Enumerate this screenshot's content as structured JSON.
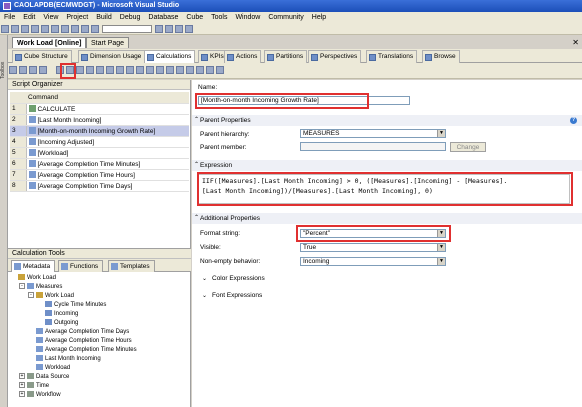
{
  "window": {
    "title": "CAOLAPDB(ECMWDGT) - Microsoft Visual Studio"
  },
  "menu": [
    "File",
    "Edit",
    "View",
    "Project",
    "Build",
    "Debug",
    "Database",
    "Cube",
    "Tools",
    "Window",
    "Community",
    "Help"
  ],
  "side_toolbox_label": "Toolbox",
  "document_tabs": [
    "Work Load [Online]",
    "Start Page"
  ],
  "designer_tabs": [
    "Cube Structure",
    "Dimension Usage",
    "Calculations",
    "KPIs",
    "Actions",
    "Partitions",
    "Perspectives",
    "Translations",
    "Browse"
  ],
  "active_designer_tab": "Calculations",
  "script_organizer": {
    "title": "Script Organizer",
    "column_header": "Command",
    "rows": [
      {
        "num": "1",
        "command": "CALCULATE"
      },
      {
        "num": "2",
        "command": "[Last Month Incoming]"
      },
      {
        "num": "3",
        "command": "[Month-on-month Incoming Growth Rate]"
      },
      {
        "num": "4",
        "command": "[Incoming Adjusted]"
      },
      {
        "num": "5",
        "command": "[Workload]"
      },
      {
        "num": "6",
        "command": "[Average Completion Time Minutes]"
      },
      {
        "num": "7",
        "command": "[Average Completion Time Hours]"
      },
      {
        "num": "8",
        "command": "[Average Completion Time Days]"
      }
    ],
    "selected_index": 2
  },
  "calc_tools": {
    "title": "Calculation Tools",
    "tabs": [
      "Metadata",
      "Functions",
      "Templates"
    ],
    "tree": [
      {
        "label": "Work Load",
        "indent": 0,
        "toggle": ""
      },
      {
        "label": "Measures",
        "indent": 1,
        "toggle": "-"
      },
      {
        "label": "Work Load",
        "indent": 2,
        "toggle": "-"
      },
      {
        "label": "Cycle Time Minutes",
        "indent": 3,
        "toggle": ""
      },
      {
        "label": "Incoming",
        "indent": 3,
        "toggle": ""
      },
      {
        "label": "Outgoing",
        "indent": 3,
        "toggle": ""
      },
      {
        "label": "Average Completion Time Days",
        "indent": 2,
        "toggle": ""
      },
      {
        "label": "Average Completion Time Hours",
        "indent": 2,
        "toggle": ""
      },
      {
        "label": "Average Completion Time Minutes",
        "indent": 2,
        "toggle": ""
      },
      {
        "label": "Last Month Incoming",
        "indent": 2,
        "toggle": ""
      },
      {
        "label": "Workload",
        "indent": 2,
        "toggle": ""
      },
      {
        "label": "Data Source",
        "indent": 1,
        "toggle": "+"
      },
      {
        "label": "Time",
        "indent": 1,
        "toggle": "+"
      },
      {
        "label": "Workflow",
        "indent": 1,
        "toggle": "+"
      }
    ]
  },
  "form": {
    "name_label": "Name:",
    "name_value": "[Month-on-month Incoming Growth Rate]",
    "parent_properties_label": "Parent Properties",
    "parent_hierarchy_label": "Parent hierarchy:",
    "parent_hierarchy_value": "MEASURES",
    "parent_member_label": "Parent member:",
    "change_button": "Change",
    "expression_label": "Expression",
    "expression_lines": [
      "IIF([Measures].[Last Month Incoming] > 0, ([Measures].[Incoming] - [Measures].",
      "[Last Month Incoming])/[Measures].[Last Month Incoming], 0)"
    ],
    "additional_properties_label": "Additional Properties",
    "format_string_label": "Format string:",
    "format_string_value": "\"Percent\"",
    "visible_label": "Visible:",
    "visible_value": "True",
    "non_empty_label": "Non-empty behavior:",
    "non_empty_value": "Incoming",
    "color_expressions_label": "Color Expressions",
    "font_expressions_label": "Font Expressions"
  },
  "colors": {
    "highlight_red": "#e03030",
    "title_blue": "#1c4fb8",
    "selected_row": "#c5cbe8"
  }
}
